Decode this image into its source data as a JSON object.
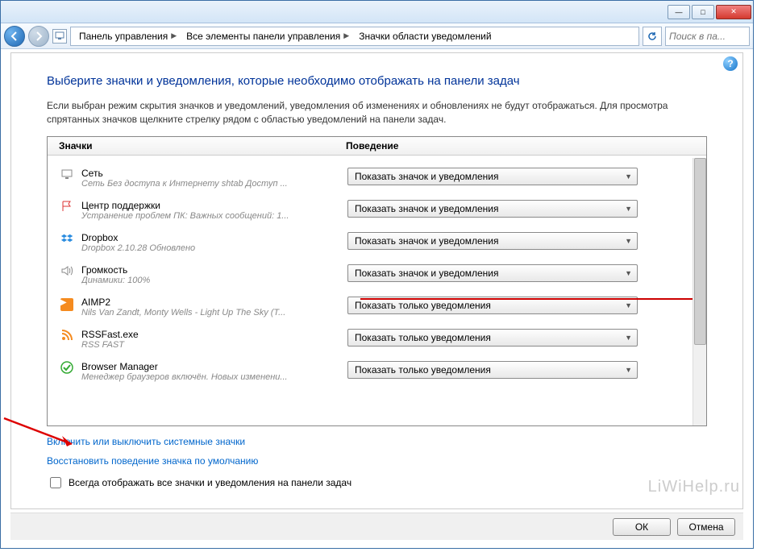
{
  "window": {
    "minimize": "—",
    "maximize": "□",
    "close": "✕"
  },
  "nav": {
    "crumb1": "Панель управления",
    "crumb2": "Все элементы панели управления",
    "crumb3": "Значки области уведомлений",
    "search_placeholder": "Поиск в па..."
  },
  "page": {
    "title": "Выберите значки и уведомления, которые необходимо отображать на панели задач",
    "desc": "Если выбран режим скрытия значков и уведомлений, уведомления об изменениях и обновлениях не будут отображаться. Для просмотра спрятанных значков щелкните стрелку рядом с областью уведомлений на панели задач."
  },
  "headers": {
    "icons": "Значки",
    "behavior": "Поведение"
  },
  "combo_options": {
    "show_all": "Показать значок и уведомления",
    "show_notif": "Показать только уведомления"
  },
  "items": [
    {
      "icon": "network-icon",
      "name": "Сеть",
      "sub": "Сеть Без доступа к Интернету shtab Доступ ...",
      "value": "show_all"
    },
    {
      "icon": "flag-icon",
      "name": "Центр поддержки",
      "sub": "Устранение проблем ПК: Важных сообщений: 1...",
      "value": "show_all"
    },
    {
      "icon": "dropbox-icon",
      "name": "Dropbox",
      "sub": "Dropbox 2.10.28 Обновлено",
      "value": "show_all"
    },
    {
      "icon": "volume-icon",
      "name": "Громкость",
      "sub": "Динамики: 100%",
      "value": "show_all",
      "highlight": true
    },
    {
      "icon": "aimp-icon",
      "name": "AIMP2",
      "sub": "Nils Van Zandt, Monty Wells - Light Up The Sky (T...",
      "value": "show_notif"
    },
    {
      "icon": "rss-icon",
      "name": "RSSFast.exe",
      "sub": "RSS FAST",
      "value": "show_notif"
    },
    {
      "icon": "checkmark-icon",
      "name": "Browser Manager",
      "sub": "Менеджер браузеров включён. Новых изменени...",
      "value": "show_notif"
    }
  ],
  "links": {
    "system_icons": "Включить или выключить системные значки",
    "restore_defaults": "Восстановить поведение значка по умолчанию"
  },
  "checkbox": {
    "label": "Всегда отображать все значки и уведомления на панели задач"
  },
  "buttons": {
    "ok": "ОК",
    "cancel": "Отмена"
  },
  "watermark": "LiWiHelp.ru"
}
